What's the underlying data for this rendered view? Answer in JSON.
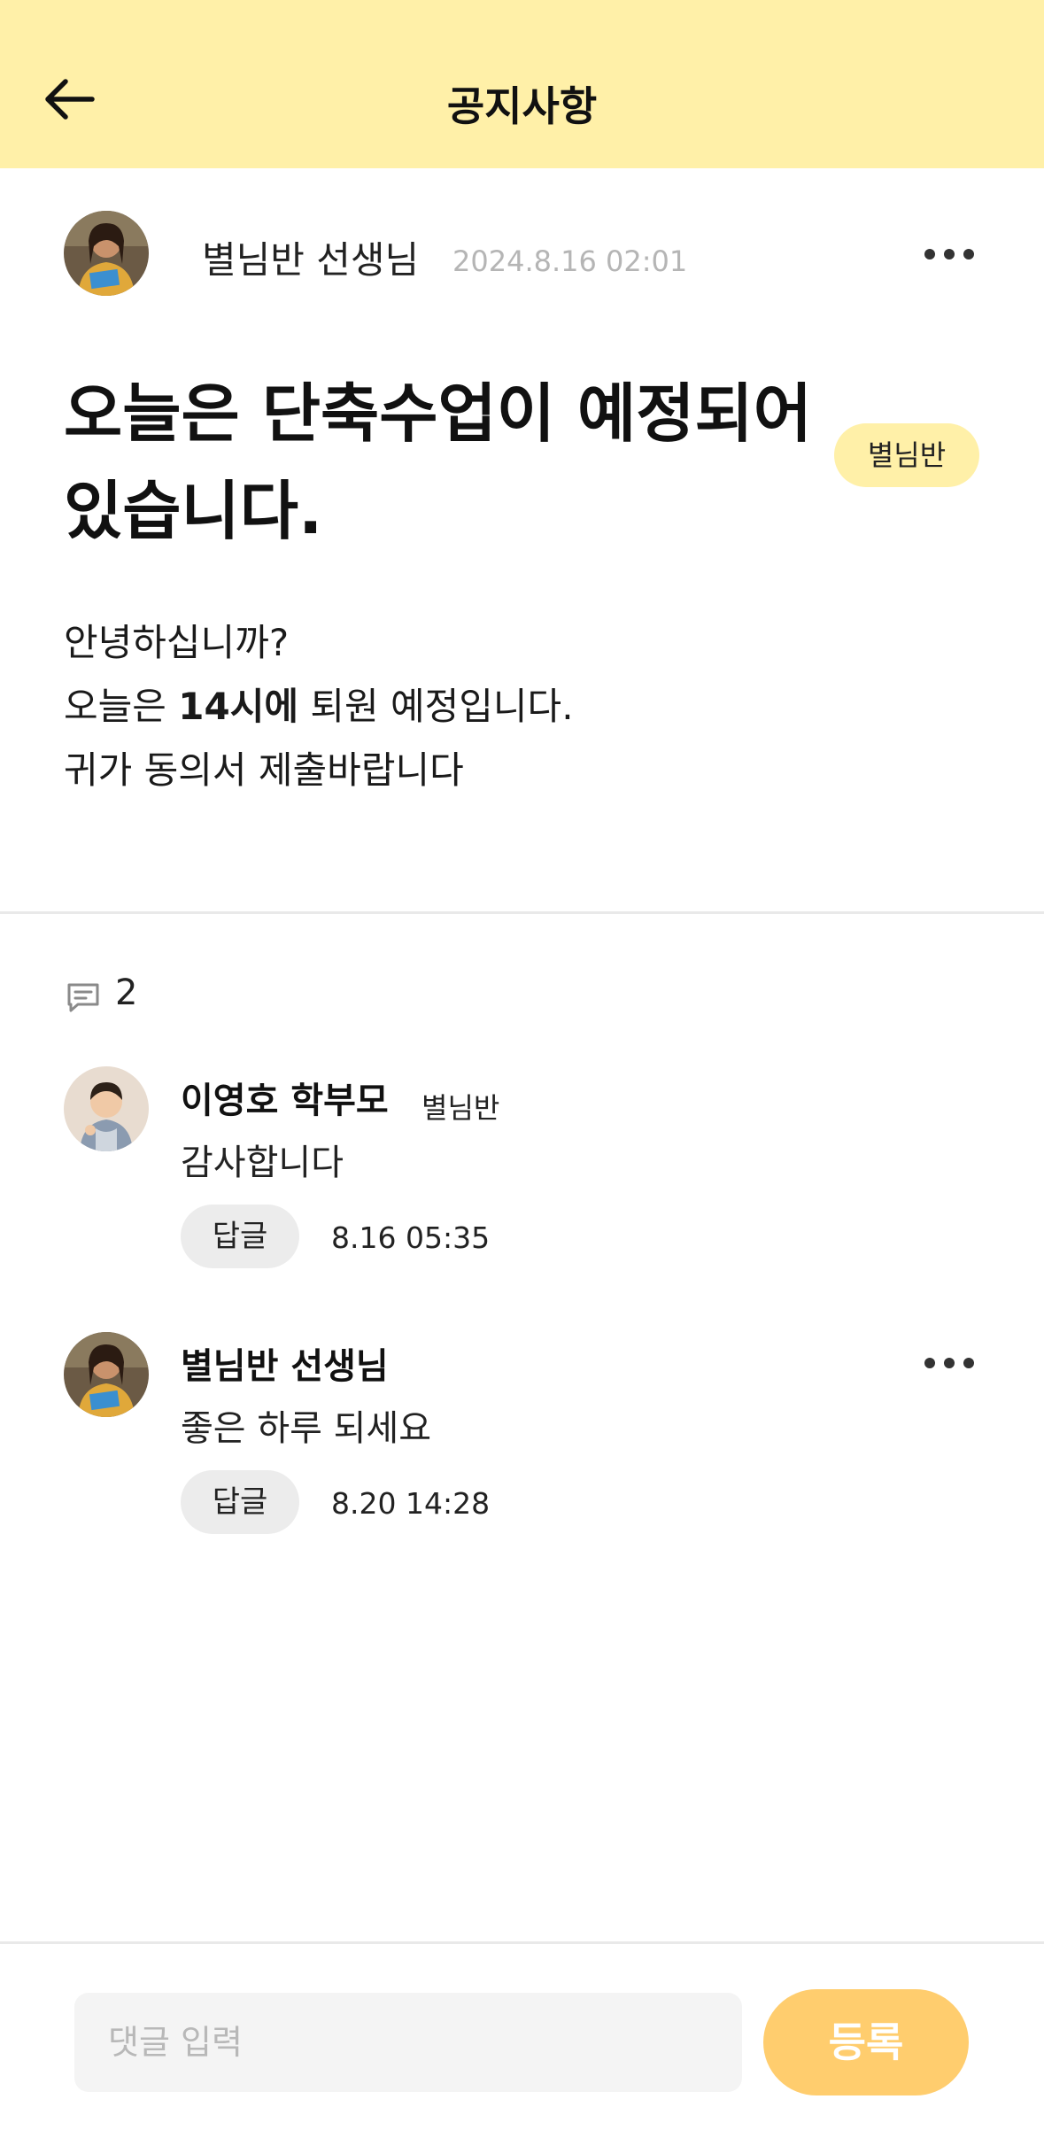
{
  "header": {
    "title": "공지사항",
    "back_icon": "arrow-left-icon",
    "background": "#fff0a8"
  },
  "post": {
    "author": "별님반 선생님",
    "date": "2024.8.16 02:01",
    "title_line1": "오늘은 단축수업이 예정되어",
    "title_line2": "있습니다.",
    "class_badge": "별님반",
    "body_line1": "안녕하십니까?",
    "body_line2_prefix": "오늘은 ",
    "body_line2_bold": "14시에",
    "body_line2_suffix": " 퇴원 예정입니다.",
    "body_line3": "귀가 동의서 제출바랍니다",
    "more_icon": "more-horizontal-icon"
  },
  "comments_section": {
    "icon": "comment-icon",
    "count": "2",
    "items": [
      {
        "name": "이영호 학부모",
        "class": "별님반",
        "text": "감사합니다",
        "reply_label": "답글",
        "time": "8.16 05:35"
      },
      {
        "name": "별님반 선생님",
        "text": "좋은 하루 되세요",
        "reply_label": "답글",
        "time": "8.20 14:28"
      }
    ]
  },
  "input_bar": {
    "placeholder": "댓글 입력",
    "submit_label": "등록",
    "submit_color": "#ffcd6e"
  }
}
